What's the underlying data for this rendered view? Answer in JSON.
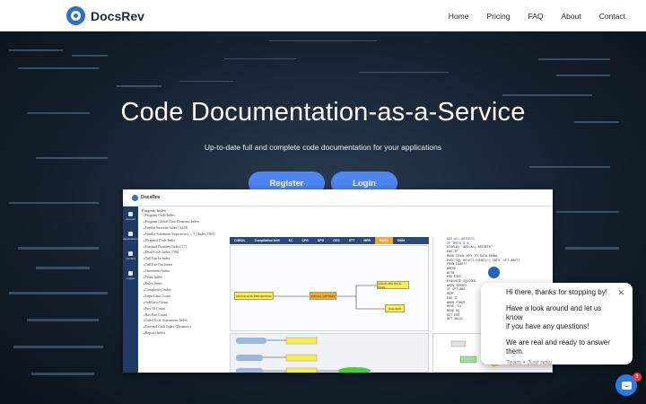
{
  "nav": {
    "brand": "DocsRev",
    "links": [
      "Home",
      "Pricing",
      "FAQ",
      "About",
      "Contact"
    ]
  },
  "hero": {
    "title": "Code Documentation-as-a-Service",
    "subtitle": "Up-to-date full and complete code documentation for your applications",
    "register_label": "Register",
    "login_label": "Login"
  },
  "preview": {
    "brand": "DocsRev",
    "sidebar": [
      "Account",
      "Applications",
      "Contact",
      "Logout"
    ],
    "tree_title": "Program Index",
    "tree_items": [
      "Program Code Index",
      "Program Global Data Elements Index",
      "Similar Records Index [4420]",
      "Similar Statement Sequences (→ 5 ) Index [504]",
      "Wrapped Code Index",
      "External Routines Index [17]",
      "Dead Code Index [796]",
      "Call Fan In Index",
      "Call Fan Out Index",
      "Statements Index",
      "Verbs Index",
      "Rules Index",
      "Complexity Index",
      "SuperClass Count",
      "SubClass Count",
      "Part Of Count",
      "Has Part Count",
      "Cobol Exec Statements Index",
      "External Calls Index (Dynamic)",
      "Reports Index"
    ],
    "tabs": [
      "COBOL",
      "Compilation Unit",
      "SC",
      "CFG",
      "DFD",
      "CEG",
      "STT",
      "MRS",
      "BASD",
      "DNM"
    ],
    "active_tab": "BASD",
    "diagram_nodes": [
      "DEVICE-END-PROCESSING",
      "ADD-ALL-ARTDEFS",
      "CHECK-MULTIPLE-FILES",
      "CALLINGS"
    ],
    "code_lines": [
      "ADD-ALL-ARTDEFS",
      "    IF TEST4 6 6",
      "       DISPLAY \"ADD-ALL-ARTDEFS\"",
      "    END-IF",
      "",
      "    MOVE CEVAL-KEY           TO SUCH-REMAL",
      "",
      "    EXEC SQL SELECT COUNT(*) INTO :CPT-ABOTT",
      "         FROM ESARTT",
      "         WHERE",
      "           WITH",
      "    END-EXEC",
      "    EVALUATE SQLCODE",
      "    WHEN ZEROES",
      "       IF CPT-ABO",
      "          PERF",
      "          END-IF",
      "    WHEN OTHER",
      "       MOVE '01",
      "       MOVE SQ",
      "       SET ERR",
      "       SET SUCCE",
      "       PERFORM",
      "    END-EVALUATE"
    ]
  },
  "chat": {
    "lines": [
      "Hi there, thanks for stopping by!",
      "Have a look around and let us know",
      "if you have any questions!",
      "We are real and ready to answer",
      "them."
    ],
    "meta": "Team • Just now",
    "badge_count": "1"
  }
}
